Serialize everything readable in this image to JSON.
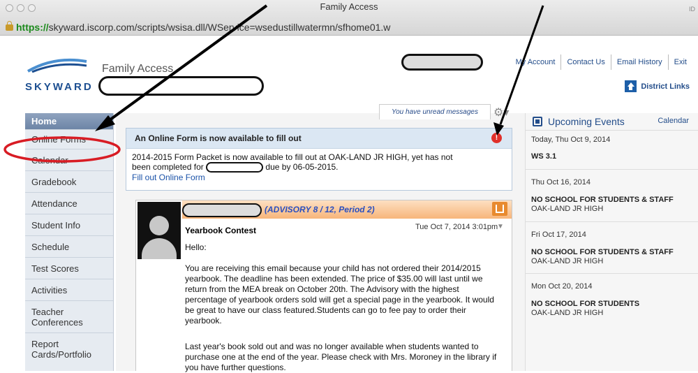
{
  "window": {
    "title": "Family Access",
    "right_hint": "ID"
  },
  "address_bar": {
    "secure_part": "https://",
    "host": "skyward.iscorp.com",
    "path": "/scripts/wsisa.dll/WService=wsedustillwatermn/sfhome01.w"
  },
  "brand": {
    "logo_text": "SKYWARD",
    "app_title": "Family Access"
  },
  "top_links": [
    "My Account",
    "Contact Us",
    "Email History",
    "Exit"
  ],
  "district_links": "District Links",
  "nav": [
    "Home",
    "Online Forms",
    "Calendar",
    "Gradebook",
    "Attendance",
    "Student Info",
    "Schedule",
    "Test Scores",
    "Activities",
    "Teacher Conferences",
    "Report Cards/Portfolio"
  ],
  "messages_tab": "You have unread messages",
  "online_form": {
    "title": "An Online Form is now available to fill out",
    "alert_symbol": "!",
    "text_1": "2014-2015 Form Packet is now available to fill out at OAK-LAND JR HIGH, yet has not",
    "text_2a": "been completed for",
    "text_2b": "due by 06-05-2015.",
    "link": "Fill out Online Form"
  },
  "message": {
    "advisory": "(ADVISORY 8 / 12, Period 2)",
    "subject": "Yearbook Contest",
    "date": "Tue Oct 7, 2014 3:01pm",
    "greeting": "Hello:",
    "para1": "You are receiving this email because your child has not ordered their 2014/2015 yearbook.  The deadline has been extended. The price of $35.00 will last until we return from the MEA break on October 20th. The Advisory with the highest percentage of yearbook orders sold will get a special page in the yearbook. It would be great to have our class featured.Students can go to fee pay to order their yearbook.",
    "para2": "Last year's book sold out and was no longer available when students wanted to purchase one at the end of the year. Please check with Mrs. Moroney in the library if you have further questions."
  },
  "upcoming": {
    "title": "Upcoming Events",
    "calendar_link": "Calendar",
    "events": [
      {
        "date": "Today, Thu Oct 9, 2014",
        "title": "WS 3.1",
        "location": ""
      },
      {
        "date": "Thu Oct 16, 2014",
        "title": "NO SCHOOL FOR STUDENTS & STAFF",
        "location": "OAK-LAND JR HIGH"
      },
      {
        "date": "Fri Oct 17, 2014",
        "title": "NO SCHOOL FOR STUDENTS & STAFF",
        "location": "OAK-LAND JR HIGH"
      },
      {
        "date": "Mon Oct 20, 2014",
        "title": "NO SCHOOL FOR STUDENTS",
        "location": "OAK-LAND JR HIGH"
      }
    ]
  }
}
